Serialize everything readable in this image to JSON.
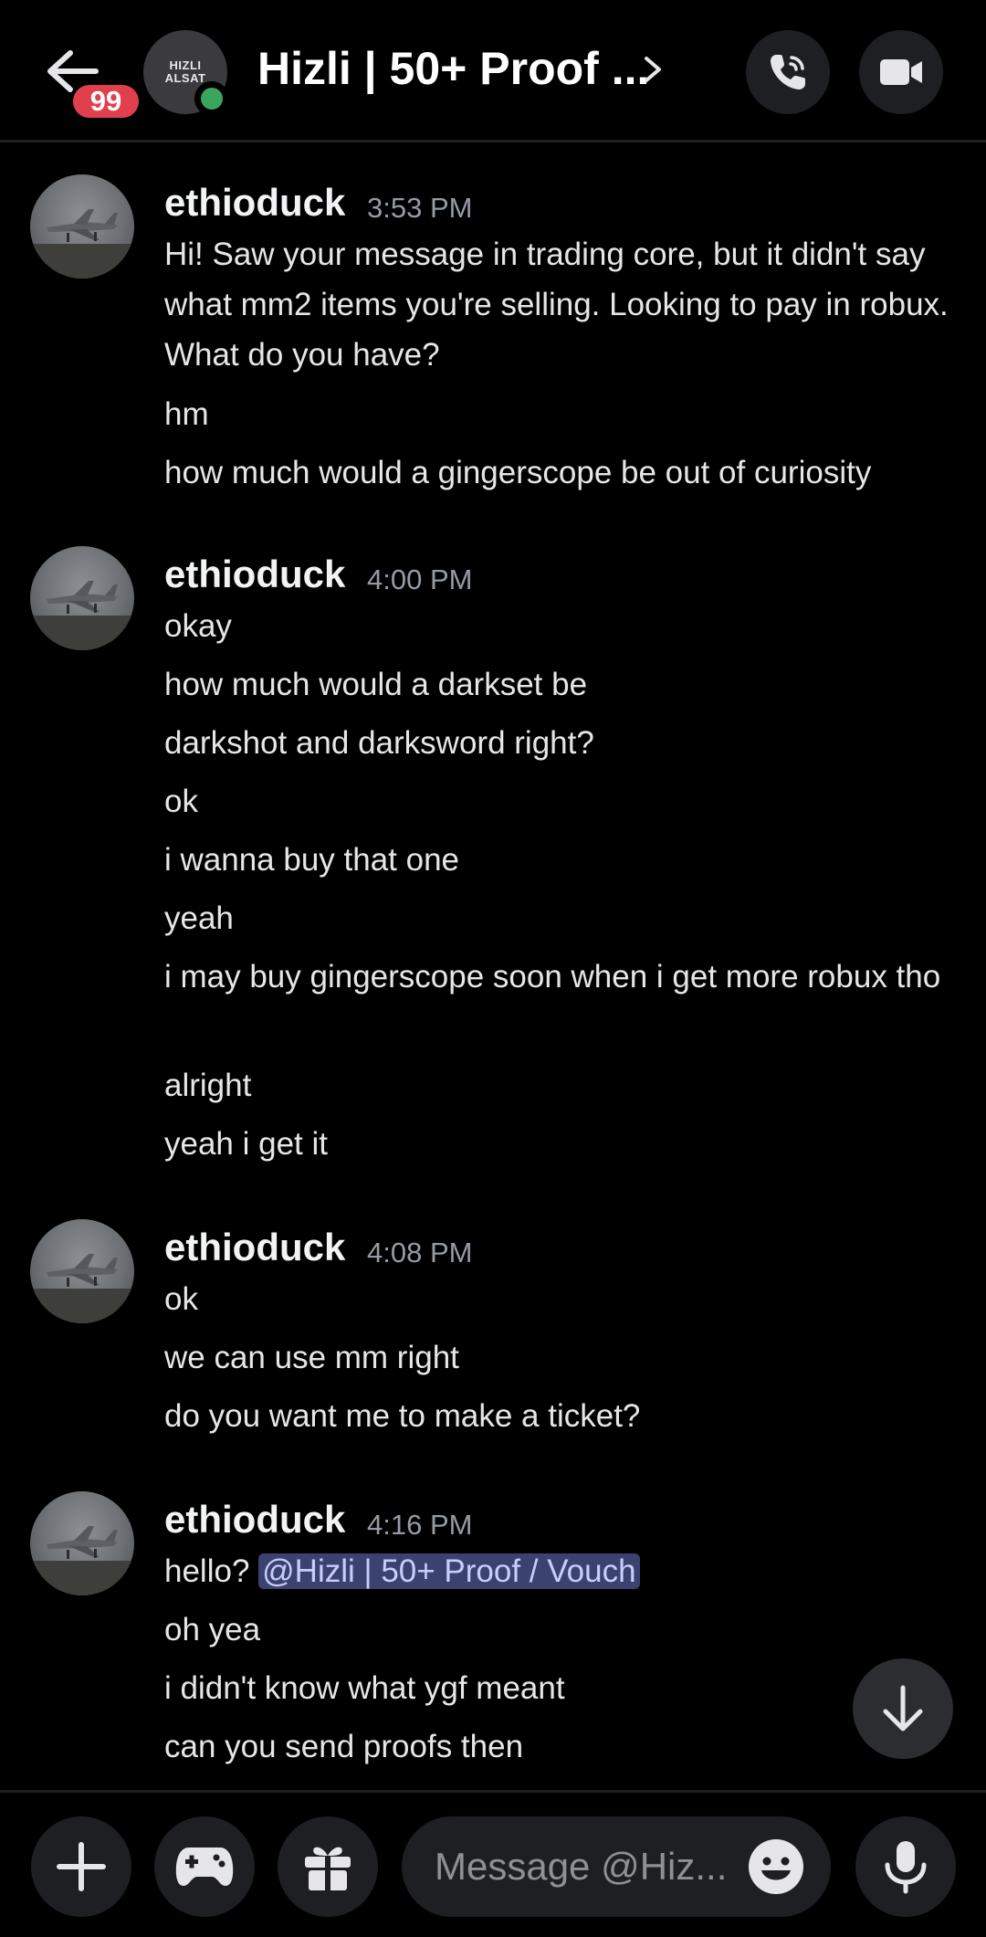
{
  "header": {
    "badge_count": "99",
    "avatar_logo_line1": "HIZLI",
    "avatar_logo_line2": "ALSAT",
    "title": "Hizli | 50+ Proof ..."
  },
  "groups": [
    {
      "username": "ethioduck",
      "time": "3:53 PM",
      "messages": [
        "Hi! Saw your message in trading core, but it didn't say what mm2 items you're selling. Looking to pay in robux. What do you have?",
        "hm",
        "how much would a gingerscope be out of curiosity"
      ]
    },
    {
      "username": "ethioduck",
      "time": "4:00 PM",
      "messages": [
        "okay",
        "how much would a darkset be",
        "darkshot and darksword right?",
        "ok",
        "i wanna buy that one",
        "yeah",
        "i may buy gingerscope soon when i get more robux tho",
        "alright",
        "yeah i get it"
      ]
    },
    {
      "username": "ethioduck",
      "time": "4:08 PM",
      "messages": [
        "ok",
        "we can use mm right",
        "do you want me to make a ticket?"
      ]
    },
    {
      "username": "ethioduck",
      "time": "4:16 PM",
      "messages": [
        "hello?",
        "oh yea",
        "i didn't know what ygf meant",
        "can you send proofs then"
      ],
      "mention": "@Hizli | 50+ Proof / Vouch"
    }
  ],
  "composer": {
    "placeholder": "Message @Hiz..."
  }
}
